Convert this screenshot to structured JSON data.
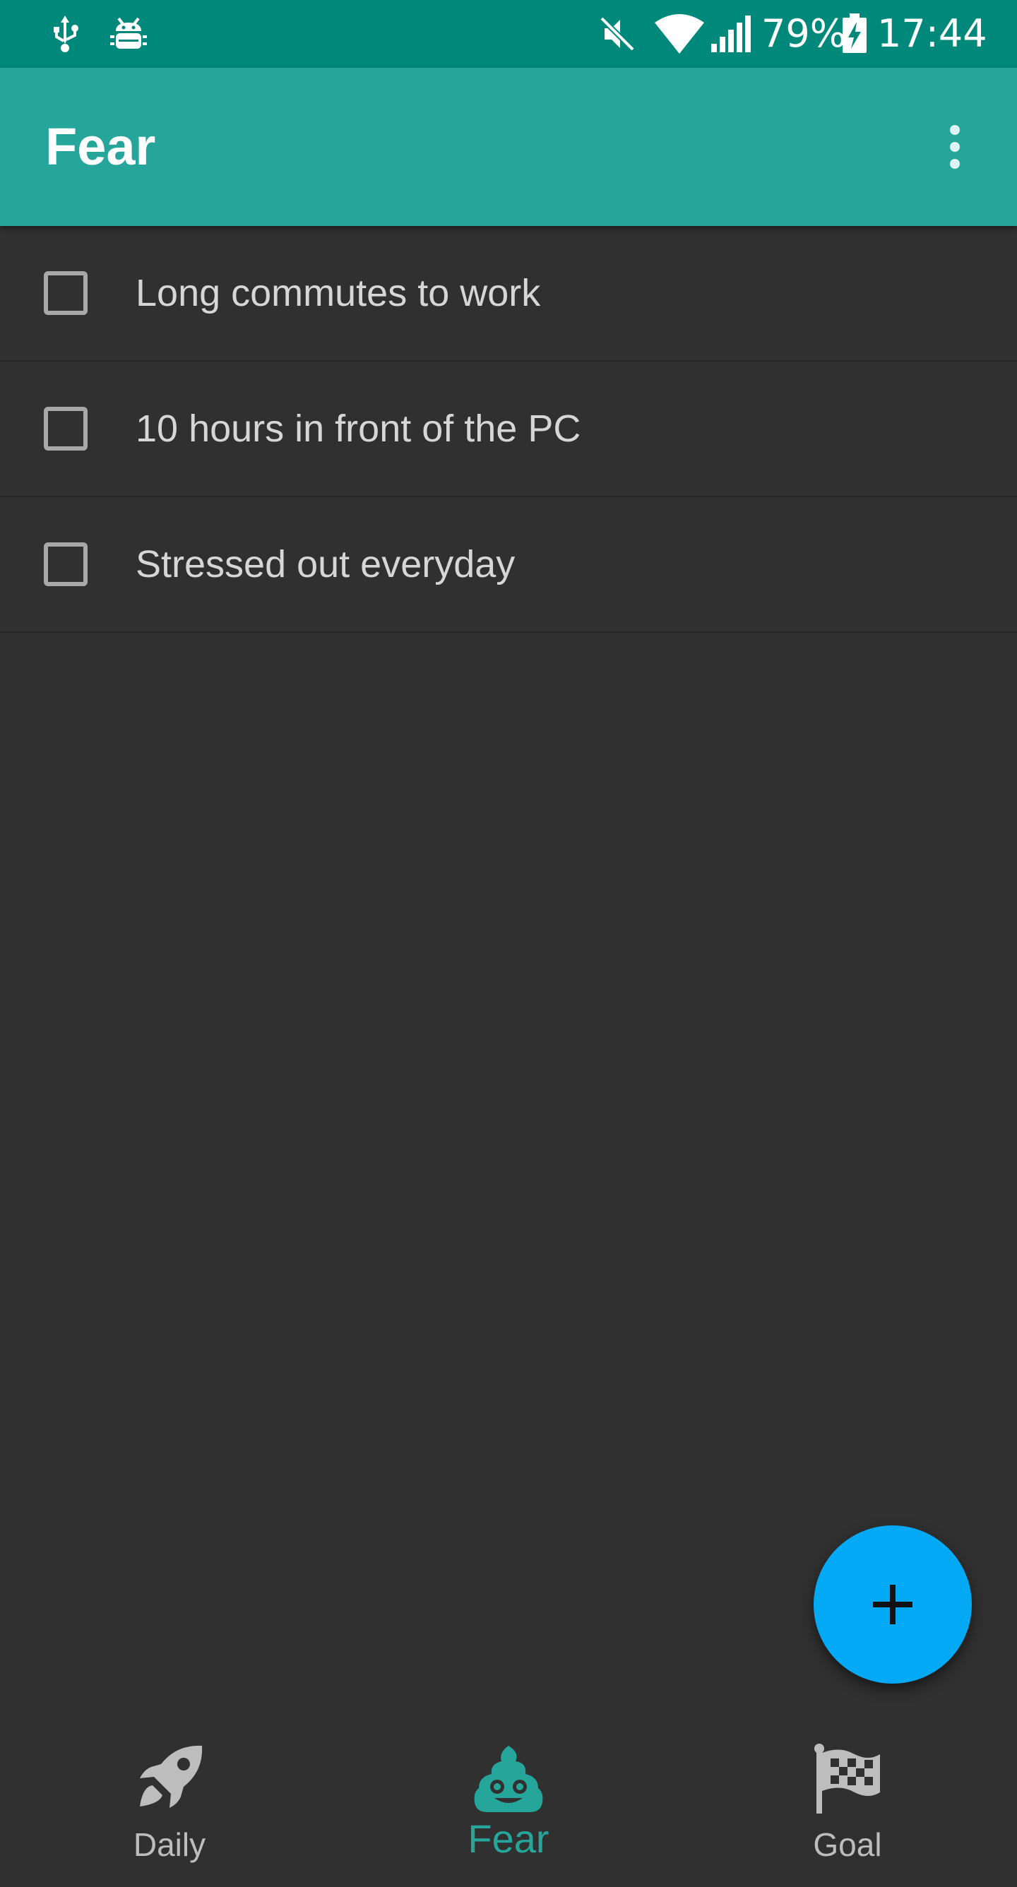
{
  "status_bar": {
    "battery_percent": "79%",
    "time": "17:44",
    "icons": [
      "usb-icon",
      "android-debug-icon",
      "mute-icon",
      "wifi-icon",
      "signal-icon",
      "battery-charging-icon"
    ]
  },
  "app_bar": {
    "title": "Fear",
    "menu_icon": "more-vert-icon"
  },
  "list": {
    "items": [
      {
        "label": "Long commutes to work",
        "checked": false
      },
      {
        "label": "10 hours in front of the PC",
        "checked": false
      },
      {
        "label": "Stressed out everyday",
        "checked": false
      }
    ]
  },
  "fab": {
    "icon": "add-icon",
    "color": "#03a9f4"
  },
  "bottom_nav": {
    "items": [
      {
        "label": "Daily",
        "icon": "rocket-icon",
        "active": false
      },
      {
        "label": "Fear",
        "icon": "poop-icon",
        "active": true
      },
      {
        "label": "Goal",
        "icon": "checkered-flag-icon",
        "active": false
      }
    ]
  },
  "colors": {
    "status_bar": "#00897b",
    "app_bar": "#26a69a",
    "background": "#303030",
    "accent": "#26a69a",
    "fab": "#03a9f4"
  }
}
